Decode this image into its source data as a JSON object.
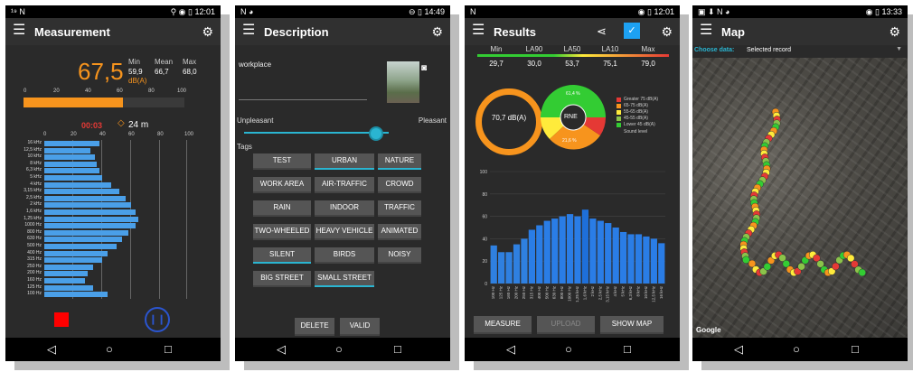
{
  "status": {
    "p1_left": "¹⁹ N",
    "p1_time": "12:01",
    "p2_left": "N ◕",
    "p2_time": "14:49",
    "p3_left": "N",
    "p3_time": "12:01",
    "p4_left": "▣ ⬇ N ◕",
    "p4_time": "13:33"
  },
  "nav": {
    "back": "◁",
    "home": "○",
    "recent": "□"
  },
  "measurement": {
    "title": "Measurement",
    "big_value": "67,5",
    "unit": "dB(A)",
    "min_label": "Min",
    "mean_label": "Mean",
    "max_label": "Max",
    "min_value": "59,9",
    "mean_value": "66,7",
    "max_value": "68,0",
    "scale_ticks": [
      "0",
      "20",
      "40",
      "60",
      "80",
      "100"
    ],
    "level_fraction": 0.62,
    "timer": "00:03",
    "distance": "24 m",
    "spectrum_labels": [
      "16 kHz",
      "12,5 kHz",
      "10 kHz",
      "8 kHz",
      "6,3 kHz",
      "5 kHz",
      "4 kHz",
      "3,15 kHz",
      "2,5 kHz",
      "2 kHz",
      "1,6 kHz",
      "1,25 kHz",
      "1000 Hz",
      "800 Hz",
      "630 Hz",
      "500 Hz",
      "400 Hz",
      "315 Hz",
      "250 Hz",
      "200 Hz",
      "160 Hz",
      "125 Hz",
      "100 Hz"
    ],
    "spectrum_values": [
      38,
      32,
      35,
      36,
      38,
      40,
      46,
      52,
      56,
      60,
      63,
      65,
      63,
      58,
      54,
      50,
      44,
      40,
      34,
      30,
      28,
      34,
      44
    ],
    "spectrum_scale": [
      "0",
      "20",
      "40",
      "60",
      "80",
      "100"
    ],
    "colors": {
      "accent": "#f7941d",
      "bar": "#4a9fe8",
      "timer": "#e53935"
    }
  },
  "description": {
    "title": "Description",
    "field_label": "workplace",
    "slider_left": "Unpleasant",
    "slider_right": "Pleasant",
    "slider_value": 0.9,
    "tags_label": "Tags",
    "tags": [
      {
        "label": "TEST",
        "selected": false
      },
      {
        "label": "URBAN",
        "selected": true
      },
      {
        "label": "NATURE",
        "selected": true
      },
      {
        "label": "WORK AREA",
        "selected": false
      },
      {
        "label": "AIR-TRAFFIC",
        "selected": false
      },
      {
        "label": "CROWD",
        "selected": false
      },
      {
        "label": "RAIN",
        "selected": false
      },
      {
        "label": "INDOOR",
        "selected": false
      },
      {
        "label": "TRAFFIC",
        "selected": false
      },
      {
        "label": "TWO-WHEELED",
        "selected": false
      },
      {
        "label": "HEAVY VEHICLE",
        "selected": false
      },
      {
        "label": "ANIMATED",
        "selected": false
      },
      {
        "label": "SILENT",
        "selected": true
      },
      {
        "label": "BIRDS",
        "selected": false
      },
      {
        "label": "NOISY",
        "selected": false
      },
      {
        "label": "BIG STREET",
        "selected": false
      },
      {
        "label": "SMALL STREET",
        "selected": true
      }
    ],
    "delete_label": "DELETE",
    "valid_label": "VALID"
  },
  "results": {
    "title": "Results",
    "stat_labels": [
      "Min",
      "LA90",
      "LA50",
      "LA10",
      "Max"
    ],
    "stat_values": [
      "29,7",
      "30,0",
      "53,7",
      "75,1",
      "79,0"
    ],
    "ring_value": "70,7 dB(A)",
    "rne_label": "RNE",
    "rne_top_pct": "61,4 %",
    "rne_bottom_pct": "21,6 %",
    "legend": [
      {
        "label": "Greater 75 dB(A)",
        "color": "#e53935"
      },
      {
        "label": "65-75 dB(A)",
        "color": "#f7941d"
      },
      {
        "label": "55-65 dB(A)",
        "color": "#ffeb3b"
      },
      {
        "label": "45-55 dB(A)",
        "color": "#8bc34a"
      },
      {
        "label": "Lower 45 dB(A)",
        "color": "#33cc33"
      }
    ],
    "legend_footer": "Sound level",
    "chart_data": {
      "type": "bar",
      "categories": [
        "100 Hz",
        "125 Hz",
        "160 Hz",
        "200 Hz",
        "250 Hz",
        "315 Hz",
        "400 Hz",
        "500 Hz",
        "630 Hz",
        "800 Hz",
        "1000 Hz",
        "1250 Hz",
        "1600 Hz",
        "2000 Hz",
        "2500 Hz",
        "3150 Hz",
        "4000 Hz",
        "5000 Hz",
        "6300 Hz",
        "8000 Hz",
        "10000 Hz",
        "12500 Hz",
        "16000 Hz"
      ],
      "tick_labels": [
        "100 Hz",
        "125 Hz",
        "160 Hz",
        "200 Hz",
        "250 Hz",
        "315 Hz",
        "400 Hz",
        "500 Hz",
        "630 Hz",
        "800 Hz",
        "1000 Hz",
        "1,25 kHz",
        "1,6 kHz",
        "2 kHz",
        "2,5 kHz",
        "3,15 kHz",
        "4 kHz",
        "5 kHz",
        "6,3 kHz",
        "8 kHz",
        "10 kHz",
        "12,5 kHz",
        "16 kHz"
      ],
      "values": [
        34,
        28,
        28,
        35,
        40,
        48,
        52,
        56,
        58,
        60,
        62,
        60,
        66,
        58,
        56,
        54,
        50,
        46,
        44,
        44,
        42,
        40,
        36
      ],
      "ylim": [
        0,
        100
      ],
      "yticks": [
        "0",
        "20",
        "40",
        "60",
        "80",
        "100"
      ],
      "highlight_index": 12
    },
    "measure_label": "MEASURE",
    "upload_label": "UPLOAD",
    "show_map_label": "SHOW MAP"
  },
  "map": {
    "title": "Map",
    "choose_label": "Choose data:",
    "selected_record": "Selected record",
    "google_label": "Google"
  }
}
